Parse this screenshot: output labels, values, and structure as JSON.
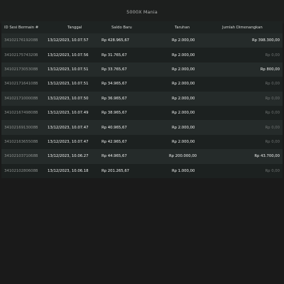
{
  "header": {
    "title": "5000X Mania"
  },
  "table": {
    "columns": [
      "ID Sesi Bermain #",
      "Tanggal",
      "Saldo Baru",
      "Taruhan",
      "Jumlah Dimenangkan"
    ],
    "rows": [
      {
        "id": "3410217619208B",
        "date": "13/12/2023, 10.07.57",
        "saldo": "Rp 428.965,67",
        "taruhan": "Rp 2.000,00",
        "win": "Rp 398.300,00",
        "win_positive": true
      },
      {
        "id": "3410217574320B",
        "date": "13/12/2023, 10.07.56",
        "saldo": "Rp 31.765,67",
        "taruhan": "Rp 2.000,00",
        "win": "Rp 0,00",
        "win_positive": false
      },
      {
        "id": "3410217305308B",
        "date": "13/12/2023, 10.07.51",
        "saldo": "Rp 33.765,67",
        "taruhan": "Rp 2.000,00",
        "win": "Rp 800,00",
        "win_positive": true
      },
      {
        "id": "3410217164108B",
        "date": "13/12/2023, 10.07.51",
        "saldo": "Rp 34.965,67",
        "taruhan": "Rp 2.000,00",
        "win": "Rp 0,00",
        "win_positive": false
      },
      {
        "id": "3410217100008B",
        "date": "13/12/2023, 10.07.50",
        "saldo": "Rp 36.965,67",
        "taruhan": "Rp 2.000,00",
        "win": "Rp 0,00",
        "win_positive": false
      },
      {
        "id": "3410216749808B",
        "date": "13/12/2023, 10.07.49",
        "saldo": "Rp 38.965,67",
        "taruhan": "Rp 2.000,00",
        "win": "Rp 0,00",
        "win_positive": false
      },
      {
        "id": "3410216913008B",
        "date": "13/12/2023, 10.07.47",
        "saldo": "Rp 40.965,67",
        "taruhan": "Rp 2.000,00",
        "win": "Rp 0,00",
        "win_positive": false
      },
      {
        "id": "3410216365508B",
        "date": "13/12/2023, 10.07.47",
        "saldo": "Rp 42.965,67",
        "taruhan": "Rp 2.000,00",
        "win": "Rp 0,00",
        "win_positive": false
      },
      {
        "id": "3410210371068B",
        "date": "13/12/2023, 10.06.27",
        "saldo": "Rp 44.965,67",
        "taruhan": "Rp 200.000,00",
        "win": "Rp 43.700,00",
        "win_positive": true
      },
      {
        "id": "3410210280608B",
        "date": "13/12/2023, 10.06.18",
        "saldo": "Rp 201.265,67",
        "taruhan": "Rp 1.000,00",
        "win": "Rp 0,00",
        "win_positive": false
      }
    ]
  }
}
